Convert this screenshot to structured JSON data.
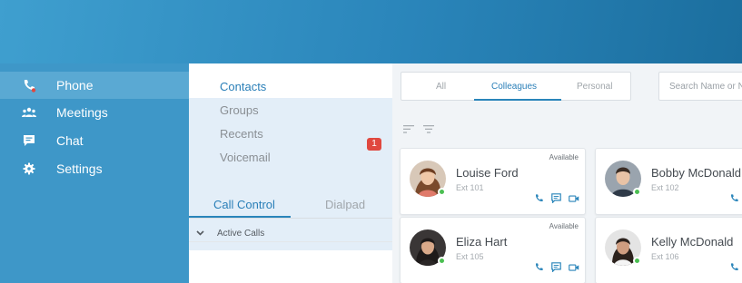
{
  "sidebar": {
    "items": [
      {
        "label": "Phone",
        "icon": "phone-icon",
        "active": true
      },
      {
        "label": "Meetings",
        "icon": "meetings-icon"
      },
      {
        "label": "Chat",
        "icon": "chat-icon"
      },
      {
        "label": "Settings",
        "icon": "settings-icon"
      }
    ]
  },
  "menu": {
    "items": [
      "Contacts",
      "Groups",
      "Recents",
      "Voicemail"
    ],
    "recents_badge": "1"
  },
  "subtabs": {
    "call_control": "Call Control",
    "dialpad": "Dialpad"
  },
  "active_calls_label": "Active Calls",
  "filter_tabs": [
    "All",
    "Colleagues",
    "Personal"
  ],
  "search": {
    "placeholder": "Search Name or Nu"
  },
  "contacts": [
    {
      "name": "Louise Ford",
      "ext": "Ext 101",
      "status": "Available"
    },
    {
      "name": "Bobby McDonald",
      "ext": "Ext 102",
      "status": ""
    },
    {
      "name": "Eliza Hart",
      "ext": "Ext 105",
      "status": "Available"
    },
    {
      "name": "Kelly McDonald",
      "ext": "Ext 106",
      "status": ""
    }
  ],
  "colors": {
    "accent": "#2a85ba",
    "sidebar": "#3e97c8",
    "presence_available": "#4bbf52",
    "badge": "#e0483f",
    "phone_icon_accent": "#e0483f"
  }
}
